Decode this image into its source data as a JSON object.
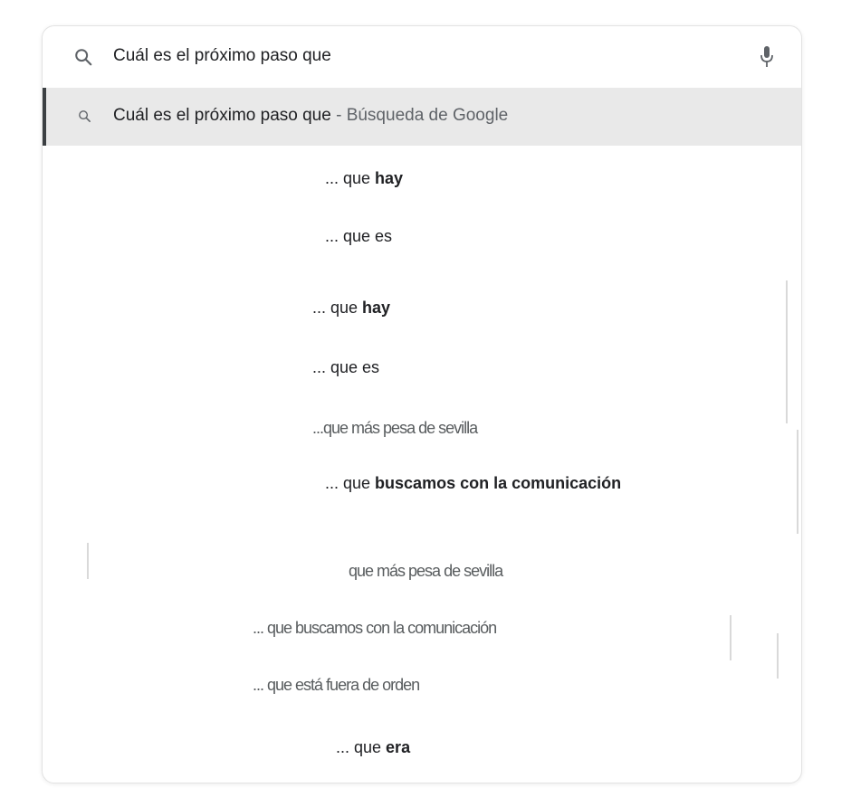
{
  "search": {
    "query": "Cuál es el próximo paso que"
  },
  "highlighted": {
    "query": "Cuál es el próximo paso que",
    "suffix": " - Búsqueda de Google"
  },
  "suggestions": [
    {
      "prefix": "... que ",
      "bold": "hay"
    },
    {
      "prefix": "... que es",
      "bold": ""
    },
    {
      "prefix": "... que ",
      "bold": "hay"
    },
    {
      "prefix": "... que es",
      "bold": ""
    },
    {
      "prefix": "...que más pesa de sevilla",
      "bold": ""
    },
    {
      "prefix": "... que ",
      "bold": "buscamos con la comunicación"
    },
    {
      "prefix": "que más pesa de sevilla",
      "bold": ""
    },
    {
      "prefix": "... que buscamos con la comunicación",
      "bold": ""
    },
    {
      "prefix": "... que está fuera de orden",
      "bold": ""
    },
    {
      "prefix": "... que ",
      "bold": "era"
    }
  ],
  "colors": {
    "text": "#202124",
    "secondary": "#5f6368",
    "highlight_bg": "#e9e9e9",
    "highlight_bar": "#3c4043"
  }
}
